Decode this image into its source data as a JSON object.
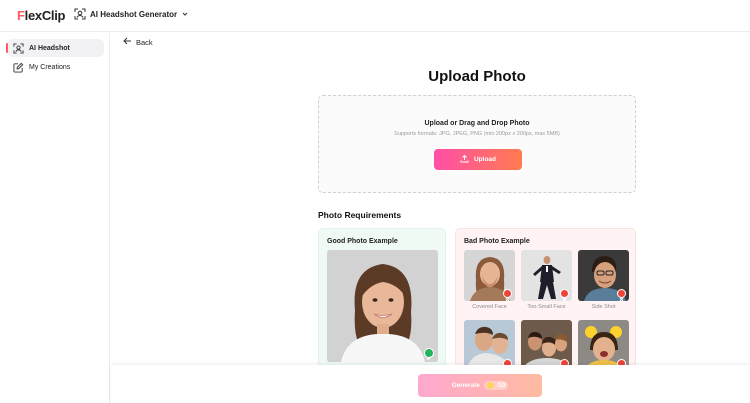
{
  "header": {
    "logo_first": "F",
    "logo_rest": "lexClip",
    "tool_name": "AI Headshot Generator",
    "icons": {
      "tool": "face-scan-icon",
      "dropdown": "chevron-down-icon"
    }
  },
  "sidebar": {
    "items": [
      {
        "label": "AI Headshot",
        "icon": "face-scan-icon",
        "active": true
      },
      {
        "label": "My Creations",
        "icon": "edit-icon",
        "active": false
      }
    ]
  },
  "main": {
    "back_label": "Back",
    "title": "Upload Photo",
    "upload": {
      "title": "Upload or Drag and Drop Photo",
      "subtitle": "Supports formats: JPG, JPEG, PNG (min 200px x 200px, max 5MB)",
      "button_label": "Upload",
      "button_icon": "upload-icon"
    },
    "requirements": {
      "title": "Photo Requirements",
      "good": {
        "title": "Good Photo Example",
        "icon": "check-icon"
      },
      "bad": {
        "title": "Bad Photo Example",
        "examples": [
          {
            "label": "Covered Face"
          },
          {
            "label": "Too-Small Face"
          },
          {
            "label": "Side Shot"
          }
        ],
        "icon": "cross-icon"
      }
    }
  },
  "footer": {
    "generate_label": "Generate",
    "credit_value": "-10"
  },
  "colors": {
    "brand": "#ff5a5f",
    "upload_gradient_start": "#ff4fa7",
    "upload_gradient_end": "#ff7b4f",
    "good_bg": "#effaf4",
    "bad_bg": "#fff4f3",
    "good_badge": "#22b35e",
    "bad_badge": "#f0433a"
  }
}
